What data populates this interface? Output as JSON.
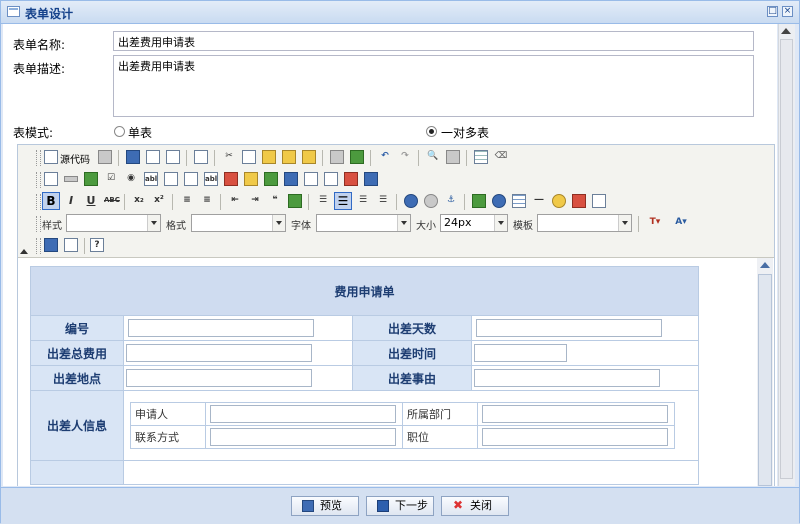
{
  "window": {
    "title": "表单设计"
  },
  "form": {
    "name_label": "表单名称:",
    "name_value": "出差费用申请表",
    "desc_label": "表单描述:",
    "desc_value": "出差费用申请表",
    "mode_label": "表模式:",
    "mode_options": [
      {
        "label": "单表",
        "selected": false
      },
      {
        "label": "一对多表",
        "selected": true
      }
    ]
  },
  "toolbar": {
    "source_label": "源代码",
    "bold": "B",
    "italic": "I",
    "underline": "U",
    "style_label": "样式",
    "format_label": "格式",
    "font_label": "字体",
    "size_label": "大小",
    "size_value": "24px",
    "template_label": "模板"
  },
  "document": {
    "title": "费用申请单",
    "rows": [
      {
        "label1": "编号",
        "label2": "出差天数"
      },
      {
        "label1": "出差总费用",
        "label2": "出差时间"
      },
      {
        "label1": "出差地点",
        "label2": "出差事由"
      }
    ],
    "person_label": "出差人信息",
    "sub_rows": [
      {
        "a": "申请人",
        "b": "所属部门"
      },
      {
        "a": "联系方式",
        "b": "职位"
      }
    ]
  },
  "buttons": {
    "preview": "预览",
    "next": "下一步",
    "close": "关闭"
  },
  "colors": {
    "window_border": "#99bbe8",
    "title_text": "#15428b",
    "form_header_bg": "#cfdcf0"
  }
}
